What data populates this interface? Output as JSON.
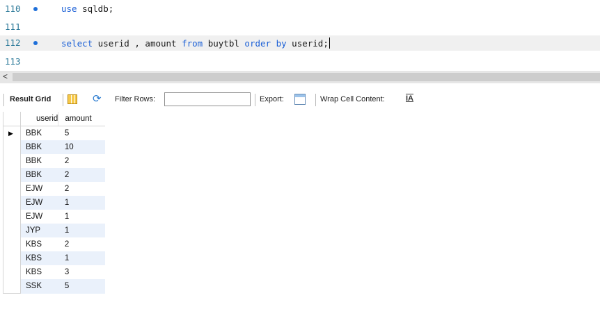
{
  "editor": {
    "lines": [
      {
        "number": "110",
        "has_dot": true,
        "text": "use sqldb;"
      },
      {
        "number": "111",
        "has_dot": false,
        "text": ""
      },
      {
        "number": "112",
        "has_dot": true,
        "text": "select userid , amount from buytbl order by userid;"
      },
      {
        "number": "113",
        "has_dot": false,
        "text": ""
      }
    ]
  },
  "scrollbar": {
    "left_arrow": "<"
  },
  "toolbar": {
    "result_grid_label": "Result Grid",
    "filter_rows_label": "Filter Rows:",
    "filter_value": "",
    "export_label": "Export:",
    "wrap_label": "Wrap Cell Content:",
    "wrap_icon_glyph": "IA"
  },
  "grid": {
    "columns": [
      "userid",
      "amount"
    ],
    "selected_row_marker": "▶",
    "rows": [
      [
        "BBK",
        "5"
      ],
      [
        "BBK",
        "10"
      ],
      [
        "BBK",
        "2"
      ],
      [
        "BBK",
        "2"
      ],
      [
        "EJW",
        "2"
      ],
      [
        "EJW",
        "1"
      ],
      [
        "EJW",
        "1"
      ],
      [
        "JYP",
        "1"
      ],
      [
        "KBS",
        "2"
      ],
      [
        "KBS",
        "1"
      ],
      [
        "KBS",
        "3"
      ],
      [
        "SSK",
        "5"
      ]
    ]
  },
  "colors": {
    "keyword": "#1a5fd6",
    "line_number": "#2d7a9a",
    "breakpoint_dot": "#1e6fd9",
    "alt_row": "#eaf1fb"
  }
}
